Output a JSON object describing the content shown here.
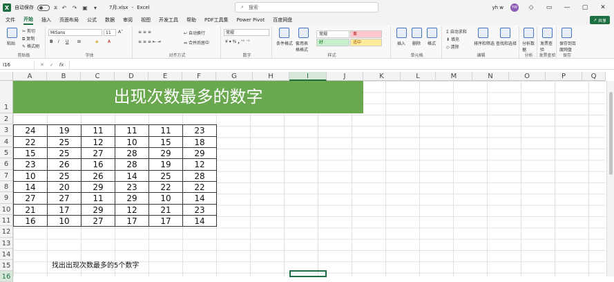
{
  "titlebar": {
    "autosave_label": "自动保存",
    "autosave_state": "关",
    "filename": "7月.xlsx",
    "app": "Excel",
    "search_placeholder": "搜索",
    "user": "yh w",
    "avatar_initials": "YW"
  },
  "menu": [
    "文件",
    "开始",
    "插入",
    "页面布局",
    "公式",
    "数据",
    "审阅",
    "视图",
    "开发工具",
    "帮助",
    "PDF工具集",
    "Power Pivot",
    "百度网盘"
  ],
  "active_menu": "开始",
  "share_label": "共享",
  "ribbon": {
    "clipboard": {
      "paste": "粘贴",
      "cut": "剪切",
      "copy": "复制",
      "format_painter": "格式刷",
      "label": "剪贴板"
    },
    "font": {
      "name": "MiSans",
      "size": "11",
      "label": "字体"
    },
    "alignment": {
      "wrap": "自动换行",
      "merge": "合并后居中",
      "label": "对齐方式"
    },
    "number": {
      "format": "常规",
      "label": "数字"
    },
    "styles": {
      "conditional": "条件格式",
      "table": "套用表格格式",
      "normal": "常规",
      "bad": "差",
      "good": "好",
      "neutral": "适中",
      "label": "样式"
    },
    "cells": {
      "insert": "插入",
      "delete": "删除",
      "format": "格式",
      "label": "单元格"
    },
    "editing": {
      "autosum": "自动求和",
      "fill": "填充",
      "clear": "清除",
      "sort": "排序和筛选",
      "find": "查找和选择",
      "label": "编辑"
    },
    "analysis": {
      "analyze": "分析数据",
      "label": "分析"
    },
    "invoice": {
      "check": "发票查验",
      "label": "发票查验"
    },
    "save": {
      "save_to": "保存到百度网盘",
      "label": "保存"
    }
  },
  "formula_bar": {
    "name_box": "I16",
    "fx": "fx",
    "value": ""
  },
  "columns": [
    "A",
    "B",
    "C",
    "D",
    "E",
    "F",
    "G",
    "H",
    "I",
    "J",
    "K",
    "L",
    "M",
    "N",
    "O",
    "P",
    "Q"
  ],
  "rows": [
    "1",
    "2",
    "3",
    "4",
    "5",
    "6",
    "7",
    "8",
    "9",
    "10",
    "11",
    "12",
    "13",
    "14",
    "15",
    "16"
  ],
  "selected": {
    "column": "I",
    "row": "16"
  },
  "banner_title": "出现次数最多的数字",
  "table": [
    [
      "24",
      "19",
      "11",
      "11",
      "11",
      "23"
    ],
    [
      "22",
      "25",
      "12",
      "10",
      "15",
      "18"
    ],
    [
      "15",
      "25",
      "27",
      "28",
      "29",
      "29"
    ],
    [
      "23",
      "26",
      "16",
      "28",
      "19",
      "12"
    ],
    [
      "10",
      "25",
      "26",
      "14",
      "25",
      "28"
    ],
    [
      "14",
      "20",
      "29",
      "23",
      "22",
      "22"
    ],
    [
      "27",
      "27",
      "11",
      "29",
      "10",
      "14"
    ],
    [
      "21",
      "17",
      "29",
      "12",
      "21",
      "23"
    ],
    [
      "16",
      "10",
      "27",
      "17",
      "17",
      "14"
    ]
  ],
  "note": "找出出现次数最多的5个数字",
  "colors": {
    "excel_green": "#1d6f42",
    "banner": "#6aa84f"
  }
}
